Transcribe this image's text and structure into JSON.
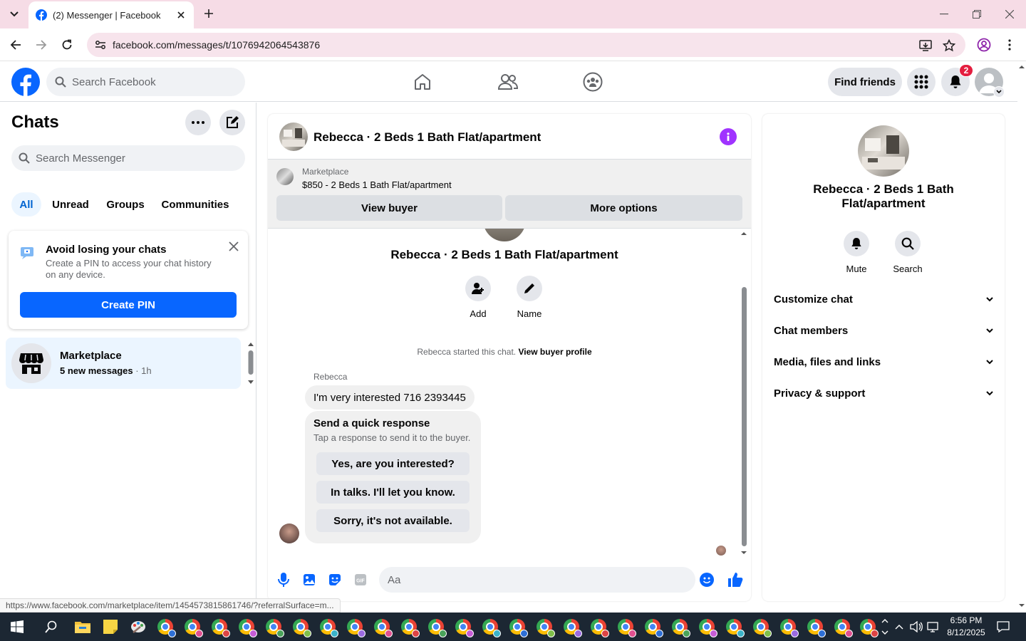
{
  "browser": {
    "tab_title": "(2) Messenger | Facebook",
    "url": "facebook.com/messages/t/1076942064543876",
    "status_url": "https://www.facebook.com/marketplace/item/1454573815861746/?referralSurface=m..."
  },
  "header": {
    "search_placeholder": "Search Facebook",
    "find_friends": "Find friends",
    "notification_count": "2"
  },
  "sidebar": {
    "title": "Chats",
    "search_placeholder": "Search Messenger",
    "filters": [
      "All",
      "Unread",
      "Groups",
      "Communities"
    ],
    "pin_card": {
      "title": "Avoid losing your chats",
      "description": "Create a PIN to access your chat history on any device.",
      "button": "Create PIN"
    },
    "chat": {
      "name": "Marketplace",
      "preview": "5 new messages",
      "time": " · 1h"
    }
  },
  "conversation": {
    "title": "Rebecca · 2 Beds 1 Bath Flat/apartment",
    "marketplace_label": "Marketplace",
    "listing": "$850 - 2 Beds 1 Bath Flat/apartment",
    "view_buyer": "View buyer",
    "more_options": "More options",
    "name": "Rebecca · 2 Beds 1 Bath Flat/apartment",
    "add_label": "Add",
    "name_label": "Name",
    "started_text": "Rebecca started this chat.",
    "view_buyer_profile": "View buyer profile",
    "sender": "Rebecca",
    "message": "I'm very interested 716 2393445",
    "quick_response": {
      "title": "Send a quick response",
      "subtitle": "Tap a response to send it to the buyer.",
      "options": [
        "Yes, are you interested?",
        "In talks. I'll let you know.",
        "Sorry, it's not available."
      ]
    },
    "composer_placeholder": "Aa"
  },
  "details": {
    "name": "Rebecca · 2 Beds 1 Bath Flat/apartment",
    "mute": "Mute",
    "search": "Search",
    "sections": [
      "Customize chat",
      "Chat members",
      "Media, files and links",
      "Privacy & support"
    ]
  },
  "taskbar": {
    "time": "6:56 PM",
    "date": "8/12/2025"
  },
  "colors": {
    "facebook_blue": "#0866ff",
    "info_purple": "#a033ff",
    "badge_red": "#e41e3f"
  }
}
